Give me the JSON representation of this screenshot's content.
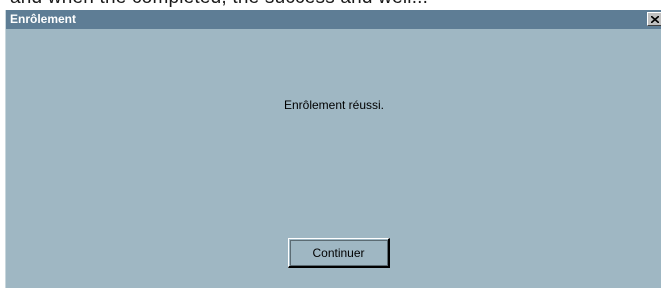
{
  "background": {
    "partial_text": "and when the completed, the success and well..."
  },
  "dialog": {
    "title": "Enrôlement",
    "message": "Enrôlement réussi.",
    "continue_label": "Continuer"
  },
  "colors": {
    "titlebar": "#5e7d95",
    "dialog_bg": "#9fb7c3",
    "title_text": "#ffffff"
  },
  "icons": {
    "close": "close-icon"
  }
}
